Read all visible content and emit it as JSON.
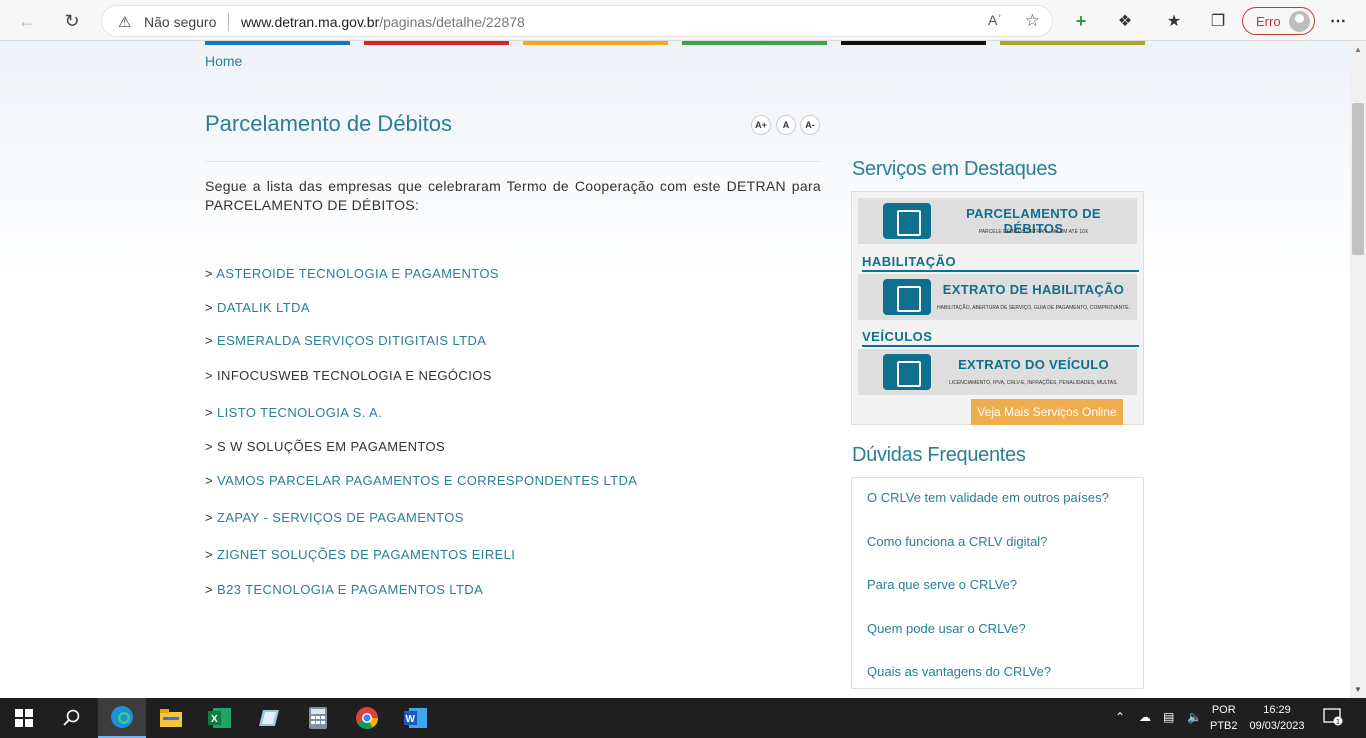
{
  "browser": {
    "security_label": "Não seguro",
    "url_host": "www.detran.ma.gov.br",
    "url_path": "/paginas/detalhe/22878",
    "read_aloud": "Aʾ",
    "profile_label": "Erro"
  },
  "page": {
    "breadcrumb": "Home",
    "title": "Parcelamento de Débitos",
    "font_controls": [
      "A+",
      "A",
      "A-"
    ],
    "intro": "Segue a lista das empresas que celebraram Termo de Cooperação com este DETRAN para PARCELAMENTO DE DÉBITOS:",
    "companies": [
      {
        "prefix": "> ",
        "name": "ASTEROIDE TECNOLOGIA E PAGAMENTOS"
      },
      {
        "prefix": "> ",
        "name": "DATALIK LTDA"
      },
      {
        "prefix": "> ",
        "name": "ESMERALDA SERVIÇOS DITIGITAIS LTDA"
      },
      {
        "prefix": "> ",
        "name": "INFOCUSWEB TECNOLOGIA E NEGÓCIOS"
      },
      {
        "prefix": "> ",
        "name": "LISTO TECNOLOGIA S. A."
      },
      {
        "prefix": "> ",
        "name": "S W SOLUÇÕES EM PAGAMENTOS"
      },
      {
        "prefix": "> ",
        "name": "VAMOS PARCELAR PAGAMENTOS E CORRESPONDENTES LTDA"
      },
      {
        "prefix": "> ",
        "name": "ZAPAY - SERVIÇOS DE PAGAMENTOS"
      },
      {
        "prefix": "> ",
        "name": "ZIGNET SOLUÇÕES DE PAGAMENTOS EIRELI"
      },
      {
        "prefix": "> ",
        "name": "B23 TECNOLOGIA E PAGAMENTOS LTDA"
      }
    ]
  },
  "sidebar": {
    "services_title": "Serviços em Destaques",
    "banner_parcelamento": {
      "title": "PARCELAMENTO DE DÉBITOS",
      "subtitle": "PARCELE DÉBITOS DETRAN - MA EM ATÉ 10X"
    },
    "cat_habilitacao": "HABILITAÇÃO",
    "banner_habilitacao": {
      "title": "EXTRATO DE HABILITAÇÃO",
      "subtitle": "HABILITAÇÃO, ABERTURA DE SERVIÇO, GUIA DE PAGAMENTO, COMPROVANTE."
    },
    "cat_veiculos": "VEÍCULOS",
    "banner_veiculo": {
      "title": "EXTRATO DO VEÍCULO",
      "subtitle": "LICENCIAMENTO, IPVA, CRLV-E, INFRAÇÕES, PENALIDADES, MULTAS."
    },
    "more_button": "Veja Mais Serviços Online",
    "faq_title": "Dúvidas Frequentes",
    "faq": [
      "O CRLVe tem validade em outros países?",
      "Como funciona a CRLV digital?",
      "Para que serve o CRLVe?",
      "Quem pode usar o CRLVe?",
      "Quais as vantagens do CRLVe?"
    ]
  },
  "taskbar": {
    "language": "POR",
    "keyboard": "PTB2",
    "time": "16:29",
    "date": "09/03/2023",
    "notification_count": "1"
  },
  "colors": {
    "accent": "#2a7f96",
    "brand_dark": "#0e6f8e",
    "button_orange": "#f0ad4e",
    "stripes": [
      "#1b75bc",
      "#d2232a",
      "#f5a623",
      "#43a047",
      "#111111",
      "#a9a62f"
    ]
  }
}
